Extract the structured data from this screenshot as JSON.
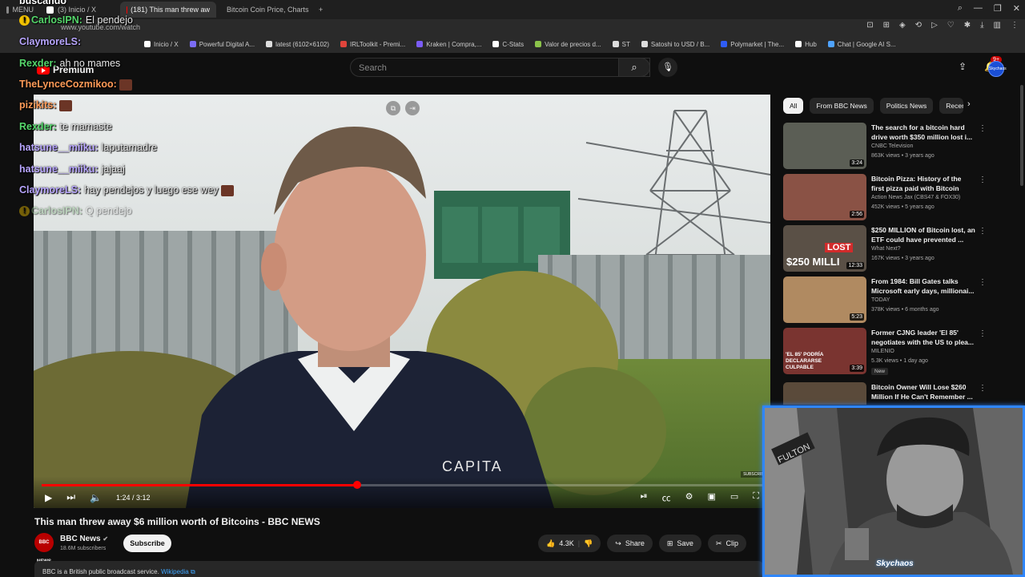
{
  "browser": {
    "tabs": [
      {
        "label": "MENU",
        "color": "#888888"
      },
      {
        "label": "(3) Inicio / X",
        "color": "#ffffff"
      },
      {
        "label": "(181) This man threw aw",
        "color": "#ff0000",
        "active": true
      },
      {
        "label": "Bitcoin Coin Price, Charts",
        "color": "#f7931a"
      }
    ],
    "url": "www.youtube.com/watch",
    "bookmarks": [
      {
        "label": "Inicio / X",
        "color": "#ffffff"
      },
      {
        "label": "Powerful Digital A...",
        "color": "#7b6cf6"
      },
      {
        "label": "latest (6102×6102)",
        "color": "#dddddd"
      },
      {
        "label": "IRLToolkit - Premi...",
        "color": "#e0443b"
      },
      {
        "label": "Kraken | Compra,...",
        "color": "#7b5cf5"
      },
      {
        "label": "C-Stats",
        "color": "#ffffff"
      },
      {
        "label": "Valor de precios d...",
        "color": "#8bc34a"
      },
      {
        "label": "ST",
        "color": "#dddddd"
      },
      {
        "label": "Satoshi to USD / B...",
        "color": "#dddddd"
      },
      {
        "label": "Polymarket | The...",
        "color": "#2f5cf5"
      },
      {
        "label": "Hub",
        "color": "#ffffff"
      },
      {
        "label": "Chat | Google AI S...",
        "color": "#4fa3ff"
      }
    ]
  },
  "header": {
    "logo": "Premium",
    "search_placeholder": "Search",
    "notif_count": "9+",
    "avatar_text": "Skychaos"
  },
  "chat": [
    {
      "user": "buscando",
      "color": "#ffffff",
      "msg": "",
      "top": 0
    },
    {
      "user": "CarlosIPN:",
      "color": "#55d66b",
      "msg": "El pendejo",
      "badge": true
    },
    {
      "user": "ClaymoreLS:",
      "color": "#b8a6ff",
      "msg": ""
    },
    {
      "user": "Rexder:",
      "color": "#55d66b",
      "msg": "ah no mames"
    },
    {
      "user": "TheLynceCozmikoo:",
      "color": "#ff9a57",
      "msg": "",
      "emote": true
    },
    {
      "user": "pizikits:",
      "color": "#ff9a57",
      "msg": "",
      "emote": true
    },
    {
      "user": "Rexder:",
      "color": "#55d66b",
      "msg": "te mamaste"
    },
    {
      "user": "hatsune__miiku:",
      "color": "#b8a6ff",
      "msg": "laputamadre"
    },
    {
      "user": "hatsune__miiku:",
      "color": "#b8a6ff",
      "msg": "jajaaj"
    },
    {
      "user": "ClaymoreLS:",
      "color": "#b8a6ff",
      "msg": "hay pendejos y luego ese wey",
      "emote": true
    },
    {
      "user": "CarlosIPN:",
      "color": "#8fbf8f",
      "msg": "Q pendejo",
      "badge": true,
      "faded": true
    }
  ],
  "video": {
    "time": "1:24 / 3:12",
    "progress": 0.438,
    "title": "This man threw away $6 million worth of Bitcoins - BBC NEWS",
    "jacket_text": "CAPITA",
    "watermark": "SUBSCRIBE"
  },
  "channel": {
    "logo": "BBC NEWS",
    "name": "BBC News",
    "subs": "18.6M subscribers",
    "subscribe": "Subscribe"
  },
  "actions": {
    "likes": "4.3K",
    "share": "Share",
    "save": "Save",
    "clip": "Clip"
  },
  "description": {
    "text": "BBC is a British public broadcast service.",
    "link": "Wikipedia"
  },
  "sidebar": {
    "chips": [
      "All",
      "From BBC News",
      "Politics News",
      "Recen"
    ],
    "recs": [
      {
        "title": "The search for a bitcoin hard drive worth $350 million lost i...",
        "channel": "CNBC Television",
        "meta": "863K views • 3 years ago",
        "dur": "3:24",
        "bg": "#5b5e55"
      },
      {
        "title": "Bitcoin Pizza: History of the first pizza paid with Bitcoin equalin...",
        "channel": "Action News Jax (CBS47 & FOX30)",
        "meta": "452K views • 5 years ago",
        "dur": "2:56",
        "bg": "#8a5245"
      },
      {
        "title": "$250 MILLION of Bitcoin lost, an ETF could have prevented ...",
        "channel": "What Next?",
        "meta": "167K views • 3 years ago",
        "dur": "12:33",
        "bg": "#5a5046",
        "overlay": "$250 MILLI",
        "tag": "LOST"
      },
      {
        "title": "From 1984: Bill Gates talks Microsoft early days, millionai...",
        "channel": "TODAY",
        "meta": "378K views • 6 months ago",
        "dur": "5:23",
        "bg": "#b08a61"
      },
      {
        "title": "Former CJNG leader 'El 85' negotiates with the US to plea...",
        "channel": "MILENIO",
        "meta": "5.3K views • 1 day ago",
        "dur": "3:39",
        "bg": "#7a3430",
        "new": "New",
        "overlay": "'EL 85' PODRÍA DECLARARSE CULPABLE"
      },
      {
        "title": "Bitcoin Owner Will Lose $260 Million If He Can't Remember ...",
        "channel": "",
        "meta": "",
        "dur": "",
        "bg": "#5a4a3a"
      }
    ]
  },
  "webcam": {
    "label": "Skychaos",
    "sign": "FULTON"
  }
}
